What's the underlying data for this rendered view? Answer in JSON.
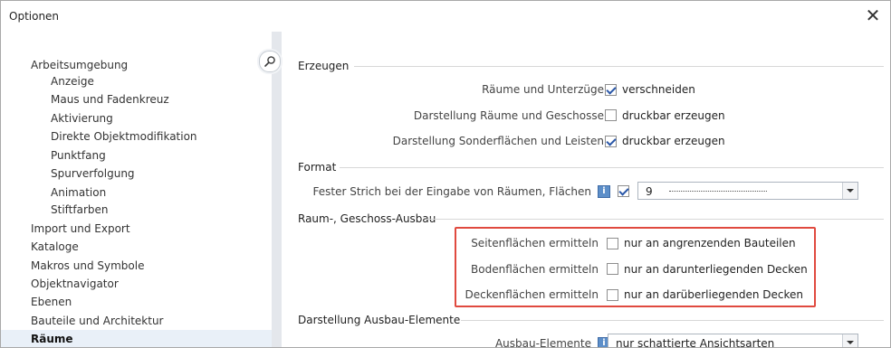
{
  "window": {
    "title": "Optionen",
    "close_glyph": "✕"
  },
  "sidebar": {
    "items": [
      {
        "label": "Arbeitsumgebung"
      },
      {
        "label": "Anzeige"
      },
      {
        "label": "Maus und Fadenkreuz"
      },
      {
        "label": "Aktivierung"
      },
      {
        "label": "Direkte Objektmodifikation"
      },
      {
        "label": "Punktfang"
      },
      {
        "label": "Spurverfolgung"
      },
      {
        "label": "Animation"
      },
      {
        "label": "Stiftfarben"
      },
      {
        "label": "Import und Export"
      },
      {
        "label": "Kataloge"
      },
      {
        "label": "Makros und Symbole"
      },
      {
        "label": "Objektnavigator"
      },
      {
        "label": "Ebenen"
      },
      {
        "label": "Bauteile und Architektur"
      },
      {
        "label": "Räume"
      }
    ],
    "active_index": 15,
    "search_icon": "search-icon"
  },
  "sections": {
    "erzeugen": {
      "title": "Erzeugen",
      "rows": [
        {
          "label": "Räume und Unterzüge",
          "checkbox_text": "verschneiden",
          "checked": true
        },
        {
          "label": "Darstellung Räume und Geschosse",
          "checkbox_text": "druckbar erzeugen",
          "checked": false
        },
        {
          "label": "Darstellung Sonderflächen und Leisten",
          "checkbox_text": "druckbar erzeugen",
          "checked": true
        }
      ]
    },
    "format": {
      "title": "Format",
      "row": {
        "label": "Fester Strich bei der Eingabe von Räumen, Flächen",
        "info_icon": "info-icon",
        "checked": true,
        "select_value": "9"
      }
    },
    "ausbau": {
      "title": "Raum-, Geschoss-Ausbau",
      "rows": [
        {
          "label": "Seitenflächen ermitteln",
          "checkbox_text": "nur an angrenzenden Bauteilen",
          "checked": false
        },
        {
          "label": "Bodenflächen ermitteln",
          "checkbox_text": "nur an darunterliegenden Decken",
          "checked": false
        },
        {
          "label": "Deckenflächen ermitteln",
          "checkbox_text": "nur an darüberliegenden Decken",
          "checked": false
        }
      ]
    },
    "darstellung_ausbau": {
      "title": "Darstellung Ausbau-Elemente",
      "row": {
        "label": "Ausbau-Elemente",
        "info_icon": "info-icon",
        "select_value": "nur schattierte Ansichtsarten"
      }
    }
  },
  "colors": {
    "highlight": "#e04a3f",
    "checkmark": "#2a57a8",
    "info": "#5d8fc9",
    "active_item_bg": "#e9f0f8"
  }
}
